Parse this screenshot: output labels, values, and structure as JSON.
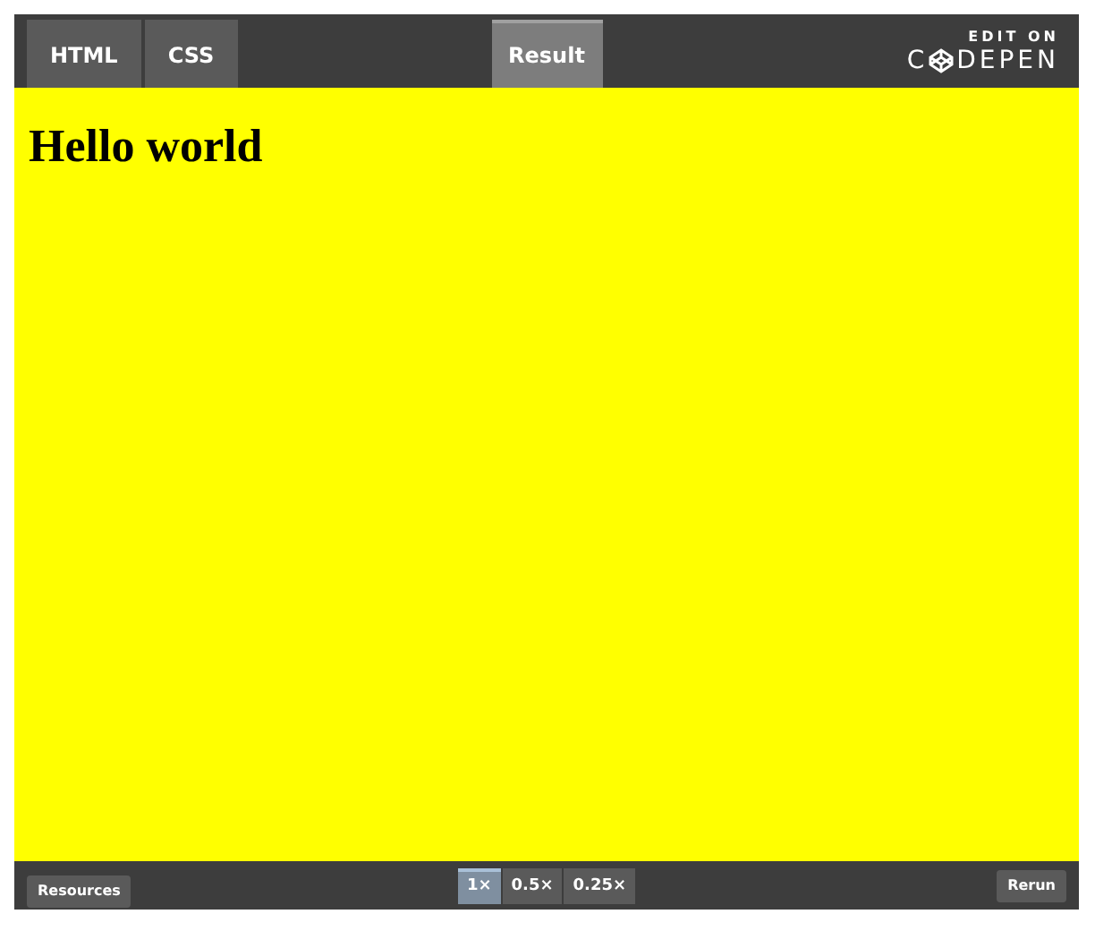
{
  "tabs": [
    {
      "label": "HTML",
      "selected": false
    },
    {
      "label": "CSS",
      "selected": false
    },
    {
      "label": "Result",
      "selected": true
    }
  ],
  "brand": {
    "caption": "EDIT ON",
    "name_start": "C",
    "name_end": "DEPEN"
  },
  "result": {
    "heading": "Hello world"
  },
  "footer": {
    "resources": "Resources",
    "zoom": [
      {
        "label": "1×",
        "selected": true
      },
      {
        "label": "0.5×",
        "selected": false
      },
      {
        "label": "0.25×",
        "selected": false
      }
    ],
    "rerun": "Rerun"
  }
}
